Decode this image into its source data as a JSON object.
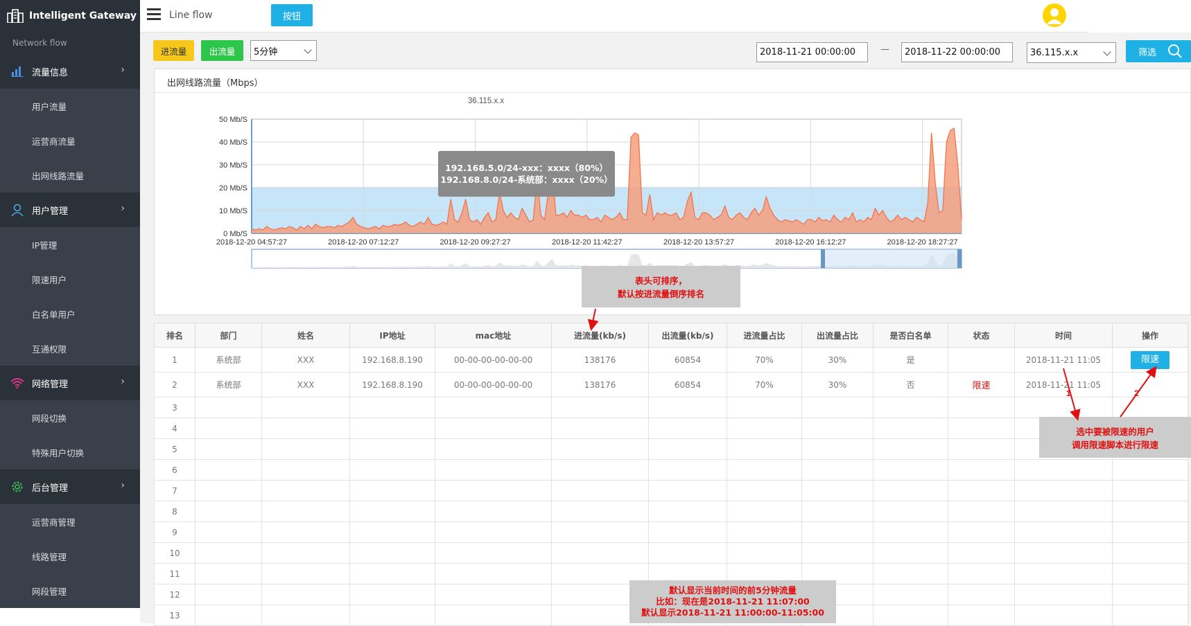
{
  "sidebar": {
    "brand": "Intelligent Gateway",
    "subtitle": "Network flow",
    "groups": [
      {
        "label": "流量信息",
        "icon": "bar-chart-icon",
        "items": [
          "用户流量",
          "运营商流量",
          "出网线路流量"
        ]
      },
      {
        "label": "用户管理",
        "icon": "user-icon",
        "items": [
          "IP管理",
          "限速用户",
          "白名单用户",
          "互通权限"
        ]
      },
      {
        "label": "网络管理",
        "icon": "wifi-icon",
        "items": [
          "网段切换",
          "特殊用户切换"
        ]
      },
      {
        "label": "后台管理",
        "icon": "gear-icon",
        "items": [
          "运营商管理",
          "线路管理",
          "网段管理"
        ]
      }
    ]
  },
  "header": {
    "page_label": "Line flow",
    "button_label": "按钮"
  },
  "filters": {
    "in_label": "进流量",
    "out_label": "出流量",
    "interval": "5分钟",
    "start": "2018-11-21 00:00:00",
    "separator": "—",
    "end": "2018-11-22 00:00:00",
    "ip": "36.115.x.x",
    "filter_label": "筛选"
  },
  "chart_panel": {
    "title": "出网线路流量（Mbps）"
  },
  "tooltip": {
    "line1": "192.168.5.0/24-xxx：xxxx（80%）",
    "line2": "192.168.8.0/24-系统部：xxxx（20%）"
  },
  "chart_data": {
    "type": "area",
    "title": "36.115.x.x",
    "ylim": [
      0,
      50
    ],
    "yticks": [
      "0 Mb/S",
      "10 Mb/S",
      "20 Mb/S",
      "30 Mb/S",
      "40 Mb/S",
      "50 Mb/S"
    ],
    "xticks": [
      "2018-12-20 04:57:27",
      "2018-12-20 07:12:27",
      "2018-12-20 09:27:27",
      "2018-12-20 11:42:27",
      "2018-12-20 13:57:27",
      "2018-12-20 16:12:27",
      "2018-12-20 18:27:27"
    ],
    "band": {
      "from": 0,
      "to": 20
    },
    "series": [
      {
        "values": [
          2,
          1.5,
          2,
          1.5,
          3,
          2,
          1.5,
          2,
          2.5,
          2,
          3,
          2.5,
          1.5,
          3,
          2,
          3.5,
          2,
          4,
          3,
          2.5,
          3,
          3,
          2.5,
          3.5,
          3,
          4,
          5,
          7,
          4,
          3,
          2.5,
          2,
          2.5,
          3,
          2,
          3.5,
          3,
          3,
          4,
          3.5,
          4,
          5,
          3.5,
          3,
          4,
          5,
          4,
          7,
          4,
          3.5,
          4,
          5,
          4,
          15,
          6,
          5,
          9,
          15,
          6,
          5,
          6,
          4,
          7,
          9,
          5,
          6,
          18,
          10,
          7,
          9,
          7,
          6,
          11,
          8,
          5,
          6,
          24,
          8,
          6,
          18,
          29,
          8,
          8,
          9,
          7,
          10,
          8,
          8,
          7,
          8,
          6,
          6,
          7,
          5,
          8,
          7,
          6,
          7,
          9,
          6,
          6,
          42,
          44,
          43,
          9,
          8,
          17,
          6,
          9,
          8,
          9,
          8,
          8,
          9,
          6,
          7,
          14,
          18,
          7,
          6,
          9,
          9,
          8,
          6,
          7,
          8,
          12,
          7,
          6,
          8,
          9,
          7,
          6,
          9,
          11,
          8,
          10,
          16,
          11,
          8,
          6,
          5,
          6,
          5.5,
          5,
          6,
          5,
          4,
          6,
          6,
          5,
          7,
          5.5,
          6,
          5,
          8,
          6,
          5,
          7,
          6,
          9,
          5,
          6,
          5,
          7,
          6,
          11,
          8,
          10,
          7,
          5,
          6,
          8,
          6,
          7,
          6,
          5,
          7,
          6,
          5,
          13,
          44,
          22,
          9,
          10,
          40,
          45,
          46,
          30,
          6
        ]
      }
    ]
  },
  "notes": {
    "sort_note": [
      "表头可排序，",
      "默认按进流量倒序排名"
    ],
    "limit_note": [
      "选中要被限速的用户",
      "调用限速脚本进行限速"
    ],
    "default_note": [
      "默认显示当前时间的前5分钟流量",
      "比如：现在是2018-11-21 11:07:00",
      "默认显示2018-11-21 11:00:00-11:05:00"
    ],
    "marker1": "1",
    "marker2": "2"
  },
  "table": {
    "headers": [
      "排名",
      "部门",
      "姓名",
      "IP地址",
      "mac地址",
      "进流量(kb/s)",
      "出流量(kb/s)",
      "进流量占比",
      "出流量占比",
      "是否白名单",
      "状态",
      "时间",
      "操作"
    ],
    "rows": [
      {
        "rank": "1",
        "dept": "系统部",
        "name": "XXX",
        "ip": "192.168.8.190",
        "mac": "00-00-00-00-00-00",
        "in": "138176",
        "out": "60854",
        "in_ratio": "70%",
        "out_ratio": "30%",
        "whitelist": "是",
        "status": "",
        "time": "2018-11-21 11:05",
        "action": "限速"
      },
      {
        "rank": "2",
        "dept": "系统部",
        "name": "XXX",
        "ip": "192.168.8.190",
        "mac": "00-00-00-00-00-00",
        "in": "138176",
        "out": "60854",
        "in_ratio": "70%",
        "out_ratio": "30%",
        "whitelist": "否",
        "status": "限速",
        "time": "2018-11-21 11:05",
        "action": ""
      }
    ],
    "empty_ranks": [
      "3",
      "4",
      "5",
      "6",
      "7",
      "8",
      "9",
      "10",
      "11",
      "12",
      "13"
    ]
  },
  "colors": {
    "accent": "#1fb1e6",
    "in_yellow": "#f7c81c",
    "out_green": "#2ec54b",
    "area_fill": "#f4a07e",
    "area_stroke": "#f2734b",
    "band": "#c7e5f8",
    "alert_red": "#e01010"
  }
}
